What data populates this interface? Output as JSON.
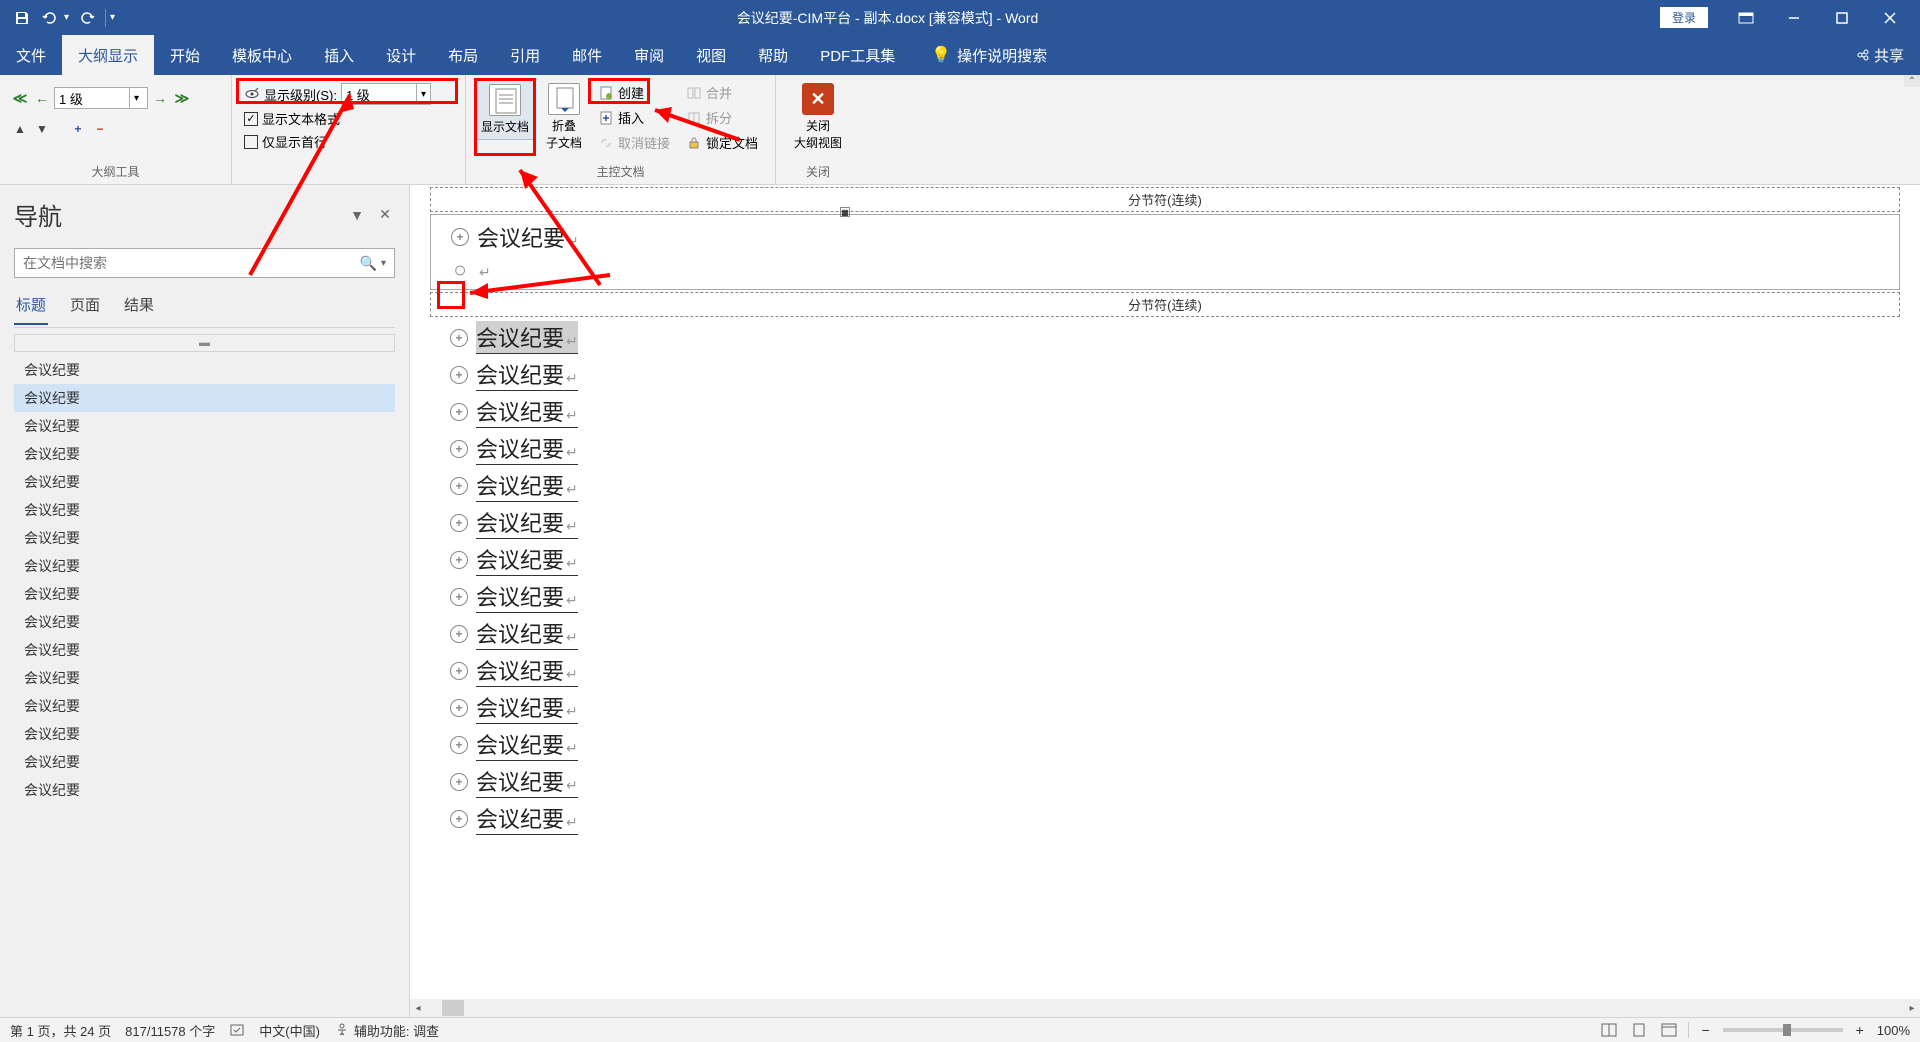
{
  "title": "会议纪要-CIM平台 - 副本.docx [兼容模式] - Word",
  "login_button": "登录",
  "menu": {
    "tabs": [
      "文件",
      "大纲显示",
      "开始",
      "模板中心",
      "插入",
      "设计",
      "布局",
      "引用",
      "邮件",
      "审阅",
      "视图",
      "帮助",
      "PDF工具集"
    ],
    "active_index": 1,
    "help_search": "操作说明搜索",
    "share": "共享"
  },
  "ribbon": {
    "outline_tools": {
      "level_select": "1 级",
      "group_label": "大纲工具"
    },
    "show": {
      "show_level_label": "显示级别(S):",
      "show_level_value": "1 级",
      "show_format": "显示文本格式",
      "show_format_checked": true,
      "show_first_line": "仅显示首行",
      "show_first_line_checked": false
    },
    "master": {
      "show_doc": "显示文档",
      "collapse_sub": "折叠\n子文档",
      "create": "创建",
      "insert": "插入",
      "unlink": "取消链接",
      "merge": "合并",
      "split": "拆分",
      "lock": "锁定文档",
      "group_label": "主控文档"
    },
    "close": {
      "close_outline": "关闭\n大纲视图",
      "group_label": "关闭"
    }
  },
  "nav": {
    "title": "导航",
    "search_placeholder": "在文档中搜索",
    "tabs": [
      "标题",
      "页面",
      "结果"
    ],
    "active_tab": 0,
    "items": [
      "会议纪要",
      "会议纪要",
      "会议纪要",
      "会议纪要",
      "会议纪要",
      "会议纪要",
      "会议纪要",
      "会议纪要",
      "会议纪要",
      "会议纪要",
      "会议纪要",
      "会议纪要",
      "会议纪要",
      "会议纪要",
      "会议纪要",
      "会议纪要"
    ],
    "selected_index": 1
  },
  "doc": {
    "section_break": "分节符(连续)",
    "heading_top": "会议纪要",
    "items": [
      "会议纪要",
      "会议纪要",
      "会议纪要",
      "会议纪要",
      "会议纪要",
      "会议纪要",
      "会议纪要",
      "会议纪要",
      "会议纪要",
      "会议纪要",
      "会议纪要",
      "会议纪要",
      "会议纪要",
      "会议纪要"
    ]
  },
  "status": {
    "page": "第 1 页，共 24 页",
    "words": "817/11578 个字",
    "lang": "中文(中国)",
    "accessibility": "辅助功能: 调查",
    "zoom": "100%"
  }
}
